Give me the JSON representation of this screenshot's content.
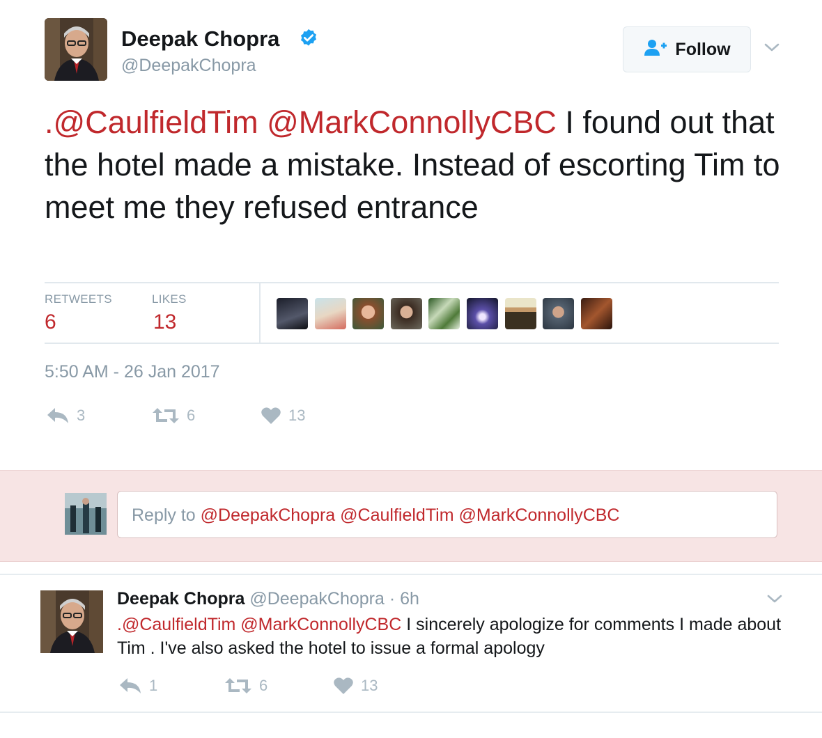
{
  "tweet": {
    "author_name": "Deepak Chopra",
    "author_handle": "@DeepakChopra",
    "follow_label": "Follow",
    "text_mention_prefix": ".",
    "mention_1": "@CaulfieldTim",
    "mention_2": "@MarkConnollyCBC",
    "text_body": " I found out that the hotel made a mistake. Instead of escorting Tim to meet me they refused entrance",
    "retweets_label": "RETWEETS",
    "retweets_value": "6",
    "likes_label": "LIKES",
    "likes_value": "13",
    "timestamp": "5:50 AM - 26 Jan 2017",
    "actions": {
      "reply_count": "3",
      "retweet_count": "6",
      "like_count": "13"
    }
  },
  "reply_composer": {
    "prefix": "Reply to ",
    "mentions": "@DeepakChopra @CaulfieldTim @MarkConnollyCBC"
  },
  "reply_tweet": {
    "author_name": "Deepak Chopra",
    "author_handle": "@DeepakChopra",
    "age": "· 6h",
    "text_prefix": ".",
    "mention_1": "@CaulfieldTim",
    "mention_2": "@MarkConnollyCBC",
    "text_body": " I sincerely apologize for comments I made about Tim . I've also asked the hotel to issue a formal apology",
    "actions": {
      "reply_count": "1",
      "retweet_count": "6",
      "like_count": "13"
    }
  },
  "colors": {
    "mention": "#c0282c",
    "verified": "#1da1f2",
    "follow_icon": "#1da1f2",
    "muted": "#8899a6",
    "reply_band": "#f7e4e4"
  },
  "icons": [
    "verified-badge-icon",
    "follow-user-icon",
    "chevron-down-icon",
    "reply-icon",
    "retweet-icon",
    "heart-icon"
  ]
}
